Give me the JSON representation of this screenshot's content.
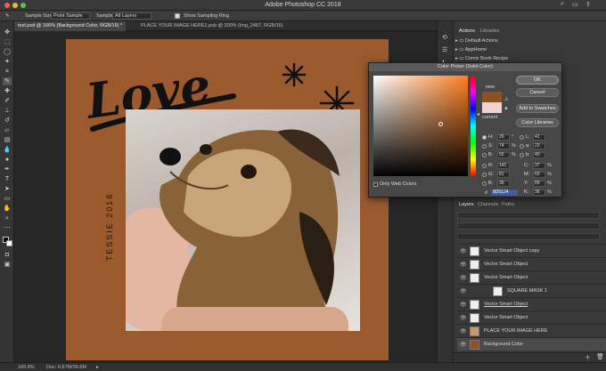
{
  "window": {
    "title": "Adobe Photoshop CC 2018"
  },
  "options_bar": {
    "sample_size_label": "Sample Size:",
    "sample_size_value": "Point Sample",
    "sample_label": "Sample:",
    "sample_value": "All Layers",
    "show_ring_label": "Show Sampling Ring"
  },
  "tabs": [
    {
      "label": "test.psd @ 166% (Background Color, RGB/16) *"
    },
    {
      "label": "PLACE YOUR IMAGE HERE1.psb @ 200% (img_2467, RGB/16)"
    }
  ],
  "artwork": {
    "headline": "Love",
    "vertical_text": "TESSIE 2018"
  },
  "color_picker": {
    "title": "Color Picker (Solid Color)",
    "new_label": "new",
    "current_label": "current",
    "ok": "OK",
    "cancel": "Cancel",
    "add_swatches": "Add to Swatches",
    "color_libraries": "Color Libraries",
    "only_web": "Only Web Colors",
    "new_color": "#8D5124",
    "current_color": "#EDD3D3",
    "hex_label": "#",
    "hex": "8D5124",
    "H": "26",
    "S": "74",
    "B": "55",
    "R": "141",
    "G": "81",
    "Bv": "36",
    "L": "41",
    "a": "23",
    "b": "40",
    "C": "37",
    "M": "69",
    "Y": "89",
    "K": "36",
    "labels": {
      "H": "H:",
      "S": "S:",
      "B": "B:",
      "R": "R:",
      "G": "G:",
      "Bv": "B:",
      "L": "L:",
      "a": "a:",
      "b": "b:",
      "C": "C:",
      "M": "M:",
      "Y": "Y:",
      "K": "K:"
    },
    "units": {
      "deg": "°",
      "pct": "%"
    }
  },
  "actions_panel": {
    "tabs": [
      "Actions",
      "Libraries"
    ],
    "items": [
      "Default Actions",
      "AppHome",
      "Comic Book Recipe"
    ]
  },
  "layers_panel": {
    "tabs": [
      "Layers",
      "Channels",
      "Paths"
    ],
    "layers": [
      "Vector Smart Object copy",
      "Vector Smart Object",
      "Vector Smart Object",
      "SQUARE MASK 1",
      "Vector Smart Object",
      "Vector Smart Object",
      "PLACE YOUR IMAGE HERE",
      "Background Color"
    ]
  },
  "status": {
    "zoom": "165.8%",
    "doc": "Doc: 6.67M/36.6M"
  },
  "colors": {
    "artboard": "#9b5a2e",
    "accent": "#8D5124"
  }
}
